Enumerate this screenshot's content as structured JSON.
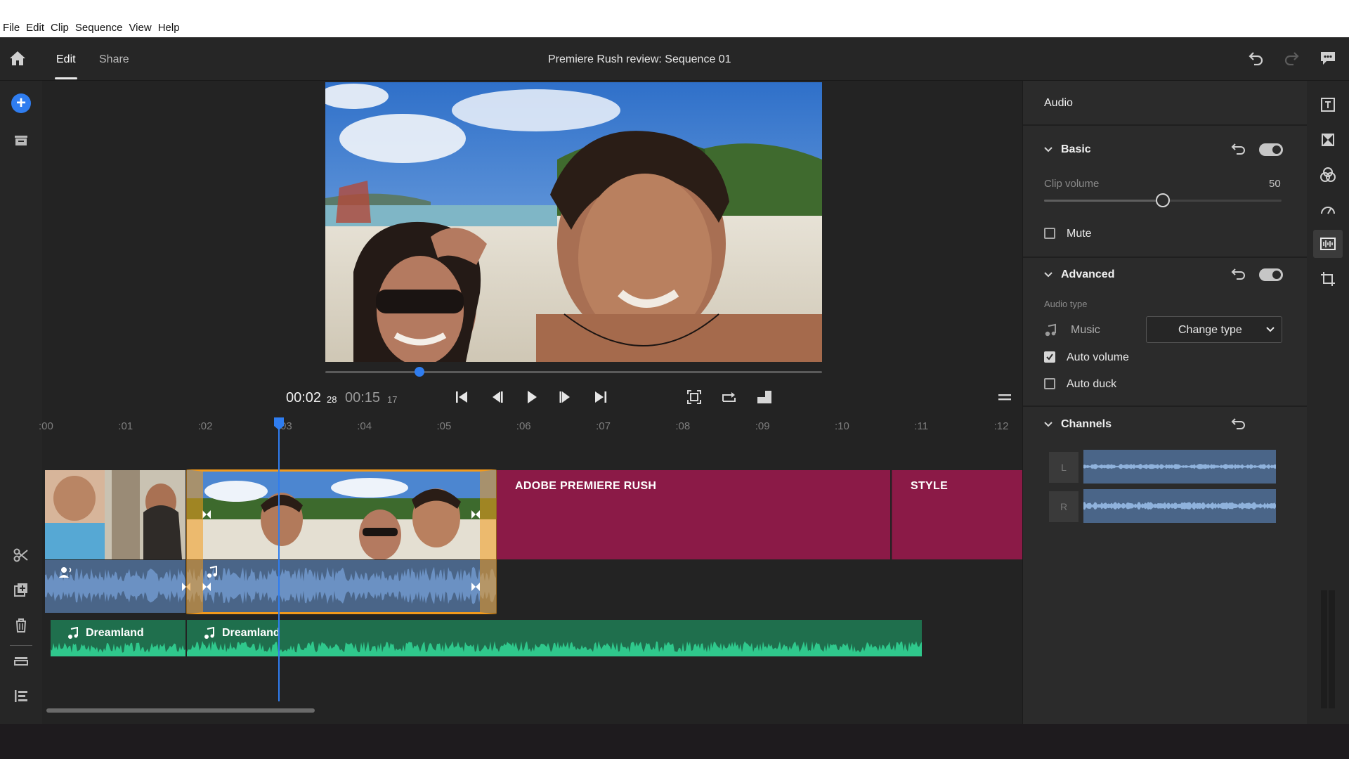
{
  "menu": [
    "File",
    "Edit",
    "Clip",
    "Sequence",
    "View",
    "Help"
  ],
  "header": {
    "tabs": [
      {
        "label": "Edit",
        "active": true
      },
      {
        "label": "Share",
        "active": false
      }
    ],
    "title": "Premiere Rush review: Sequence 01"
  },
  "player": {
    "current_time": "00:02",
    "current_frames": "28",
    "duration": "00:15",
    "duration_frames": "17",
    "scrub_position": 0.19
  },
  "timeline": {
    "ruler_labels": [
      ":00",
      ":01",
      ":02",
      ":03",
      ":04",
      ":05",
      ":06",
      ":07",
      ":08",
      ":09",
      ":10",
      ":11",
      ":12"
    ],
    "titles": [
      "ADOBE PREMIERE RUSH",
      "STYLE"
    ],
    "music_clips": [
      "Dreamland",
      "Dreamland"
    ]
  },
  "panel": {
    "title": "Audio",
    "basic": {
      "heading": "Basic",
      "clip_volume_label": "Clip volume",
      "clip_volume_value": "50",
      "clip_volume_fraction": 0.5,
      "mute_label": "Mute",
      "mute_checked": false
    },
    "advanced": {
      "heading": "Advanced",
      "audio_type_label": "Audio type",
      "type_value": "Music",
      "change_type_label": "Change type",
      "auto_volume_label": "Auto volume",
      "auto_volume_checked": true,
      "auto_duck_label": "Auto duck",
      "auto_duck_checked": false
    },
    "channels": {
      "heading": "Channels",
      "left_label": "L",
      "right_label": "R"
    }
  },
  "colors": {
    "accent": "#2f7df0",
    "title_clip": "#8b1a47",
    "audio_clip": "#4a6588",
    "music_clip": "#1f6f4d",
    "selection": "#f29a1c"
  },
  "icons": {
    "home": "home-icon",
    "undo": "undo-icon",
    "redo": "redo-icon",
    "feedback": "feedback-icon"
  }
}
